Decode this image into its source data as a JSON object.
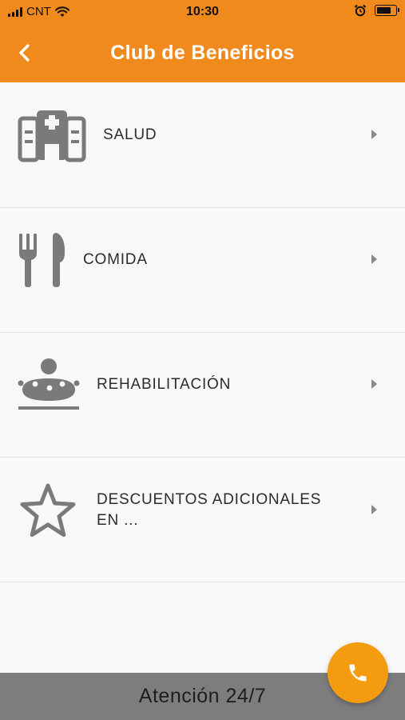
{
  "status_bar": {
    "carrier": "CNT",
    "time": "10:30",
    "battery_level": 0.85
  },
  "header": {
    "title": "Club de Beneficios",
    "back_icon": "chevron-left-icon"
  },
  "categories": [
    {
      "label": "SALUD",
      "icon": "hospital-icon"
    },
    {
      "label": "COMIDA",
      "icon": "fork-knife-icon"
    },
    {
      "label": "REHABILITACIÓN",
      "icon": "massage-icon"
    },
    {
      "label_line1": "DESCUENTOS ADICIONALES",
      "label_line2": "EN ...",
      "icon": "star-icon"
    }
  ],
  "footer": {
    "label": "Atención 24/7"
  },
  "fab": {
    "icon": "phone-icon"
  },
  "colors": {
    "header": "#f08a1c",
    "fab": "#f59b10",
    "icon_gray": "#7a7a7a",
    "footer": "#7d7d7d"
  }
}
